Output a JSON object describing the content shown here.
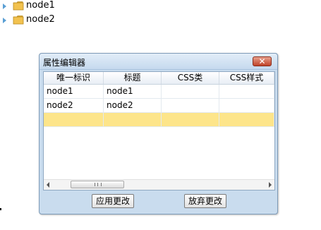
{
  "tree": {
    "nodes": [
      {
        "label": "node1"
      },
      {
        "label": "node2"
      }
    ]
  },
  "dialog": {
    "title": "属性编辑器",
    "close_glyph": "✕",
    "columns": [
      "唯一标识",
      "标题",
      "CSS类",
      "CSS样式"
    ],
    "rows": [
      [
        "node1",
        "node1",
        "",
        ""
      ],
      [
        "node2",
        "node2",
        "",
        ""
      ],
      [
        "",
        "",
        "",
        ""
      ]
    ],
    "apply_label": "应用更改",
    "discard_label": "放弃更改"
  },
  "colors": {
    "new_row_highlight": "#fde58a",
    "dialog_background": "#c9dcee",
    "close_button": "#c0432a",
    "folder": "#f2c24f"
  }
}
